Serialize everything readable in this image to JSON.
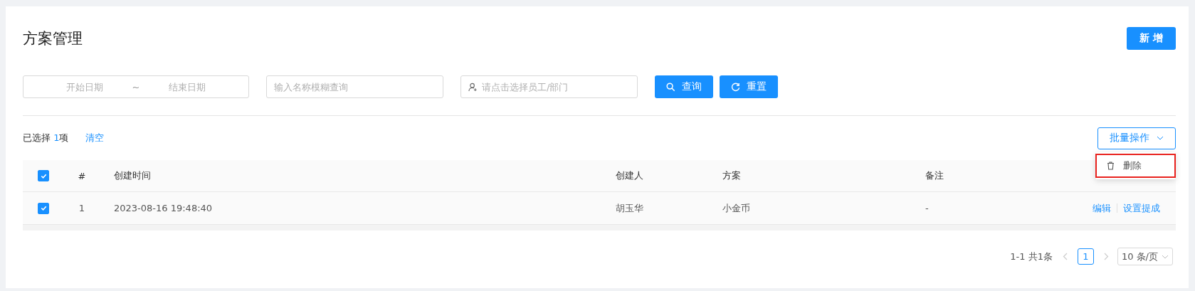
{
  "page": {
    "title": "方案管理",
    "add_button": "新 增"
  },
  "filters": {
    "start_date": {
      "placeholder": "开始日期"
    },
    "range_separator": "~",
    "end_date": {
      "placeholder": "结束日期"
    },
    "name": {
      "placeholder": "输入名称模糊查询"
    },
    "staff": {
      "placeholder": "请点击选择员工/部门"
    }
  },
  "actions": {
    "search": "查询",
    "reset": "重置"
  },
  "selection": {
    "prefix": "已选择",
    "count": "1",
    "suffix": "项",
    "clear": "清空"
  },
  "batch": {
    "label": "批量操作",
    "expanded": true,
    "menu": [
      {
        "label": "删除",
        "highlighted": true
      }
    ]
  },
  "table": {
    "header_checked": true,
    "columns": [
      "#",
      "创建时间",
      "创建人",
      "方案",
      "备注"
    ],
    "rows": [
      {
        "checked": true,
        "cells": [
          "1",
          "2023-08-16 19:48:40",
          "胡玉华",
          "小金币",
          "-"
        ],
        "links": [
          "编辑",
          "设置提成"
        ]
      }
    ]
  },
  "pagination": {
    "summary": "1-1 共1条",
    "pages": [
      {
        "label": "1",
        "selected": true
      }
    ],
    "page_size": "10 条/页"
  }
}
